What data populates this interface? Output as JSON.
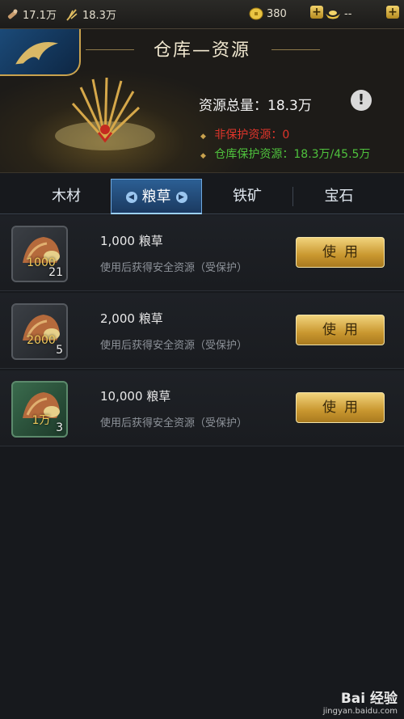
{
  "topbar": {
    "resources": [
      {
        "icon": "wood-icon",
        "value": "17.1万"
      },
      {
        "icon": "grain-icon",
        "value": "18.3万"
      },
      {
        "icon": "coin-icon",
        "value": "380"
      },
      {
        "icon": "gold-ingot-icon",
        "value": "--"
      }
    ],
    "plus_label": "+"
  },
  "header": {
    "title": "仓库—资源",
    "total_label": "资源总量：18.3万",
    "unprotected_label": "非保护资源：",
    "unprotected_value": "0",
    "protected_label": "仓库保护资源：",
    "protected_value": "18.3万/45.5万",
    "info_symbol": "!"
  },
  "tabs": [
    {
      "label": "木材",
      "active": false
    },
    {
      "label": "粮草",
      "active": true
    },
    {
      "label": "铁矿",
      "active": false
    },
    {
      "label": "宝石",
      "active": false
    }
  ],
  "items": [
    {
      "name": "1,000  粮草",
      "badge": "1000",
      "count": "21",
      "desc": "使用后获得安全资源（受保护）",
      "button": "使用",
      "rarity": "gray"
    },
    {
      "name": "2,000  粮草",
      "badge": "2000",
      "count": "5",
      "desc": "使用后获得安全资源（受保护）",
      "button": "使用",
      "rarity": "gray"
    },
    {
      "name": "10,000  粮草",
      "badge": "1万",
      "count": "3",
      "desc": "使用后获得安全资源（受保护）",
      "button": "使用",
      "rarity": "green"
    }
  ],
  "footer": {
    "logo": "Bai 经验",
    "url": "jingyan.baidu.com"
  },
  "colors": {
    "unprotected": "#e0352b",
    "protected": "#4fc23d",
    "accent_gold": "#c9a24e",
    "tab_active": "#2c5f94"
  }
}
